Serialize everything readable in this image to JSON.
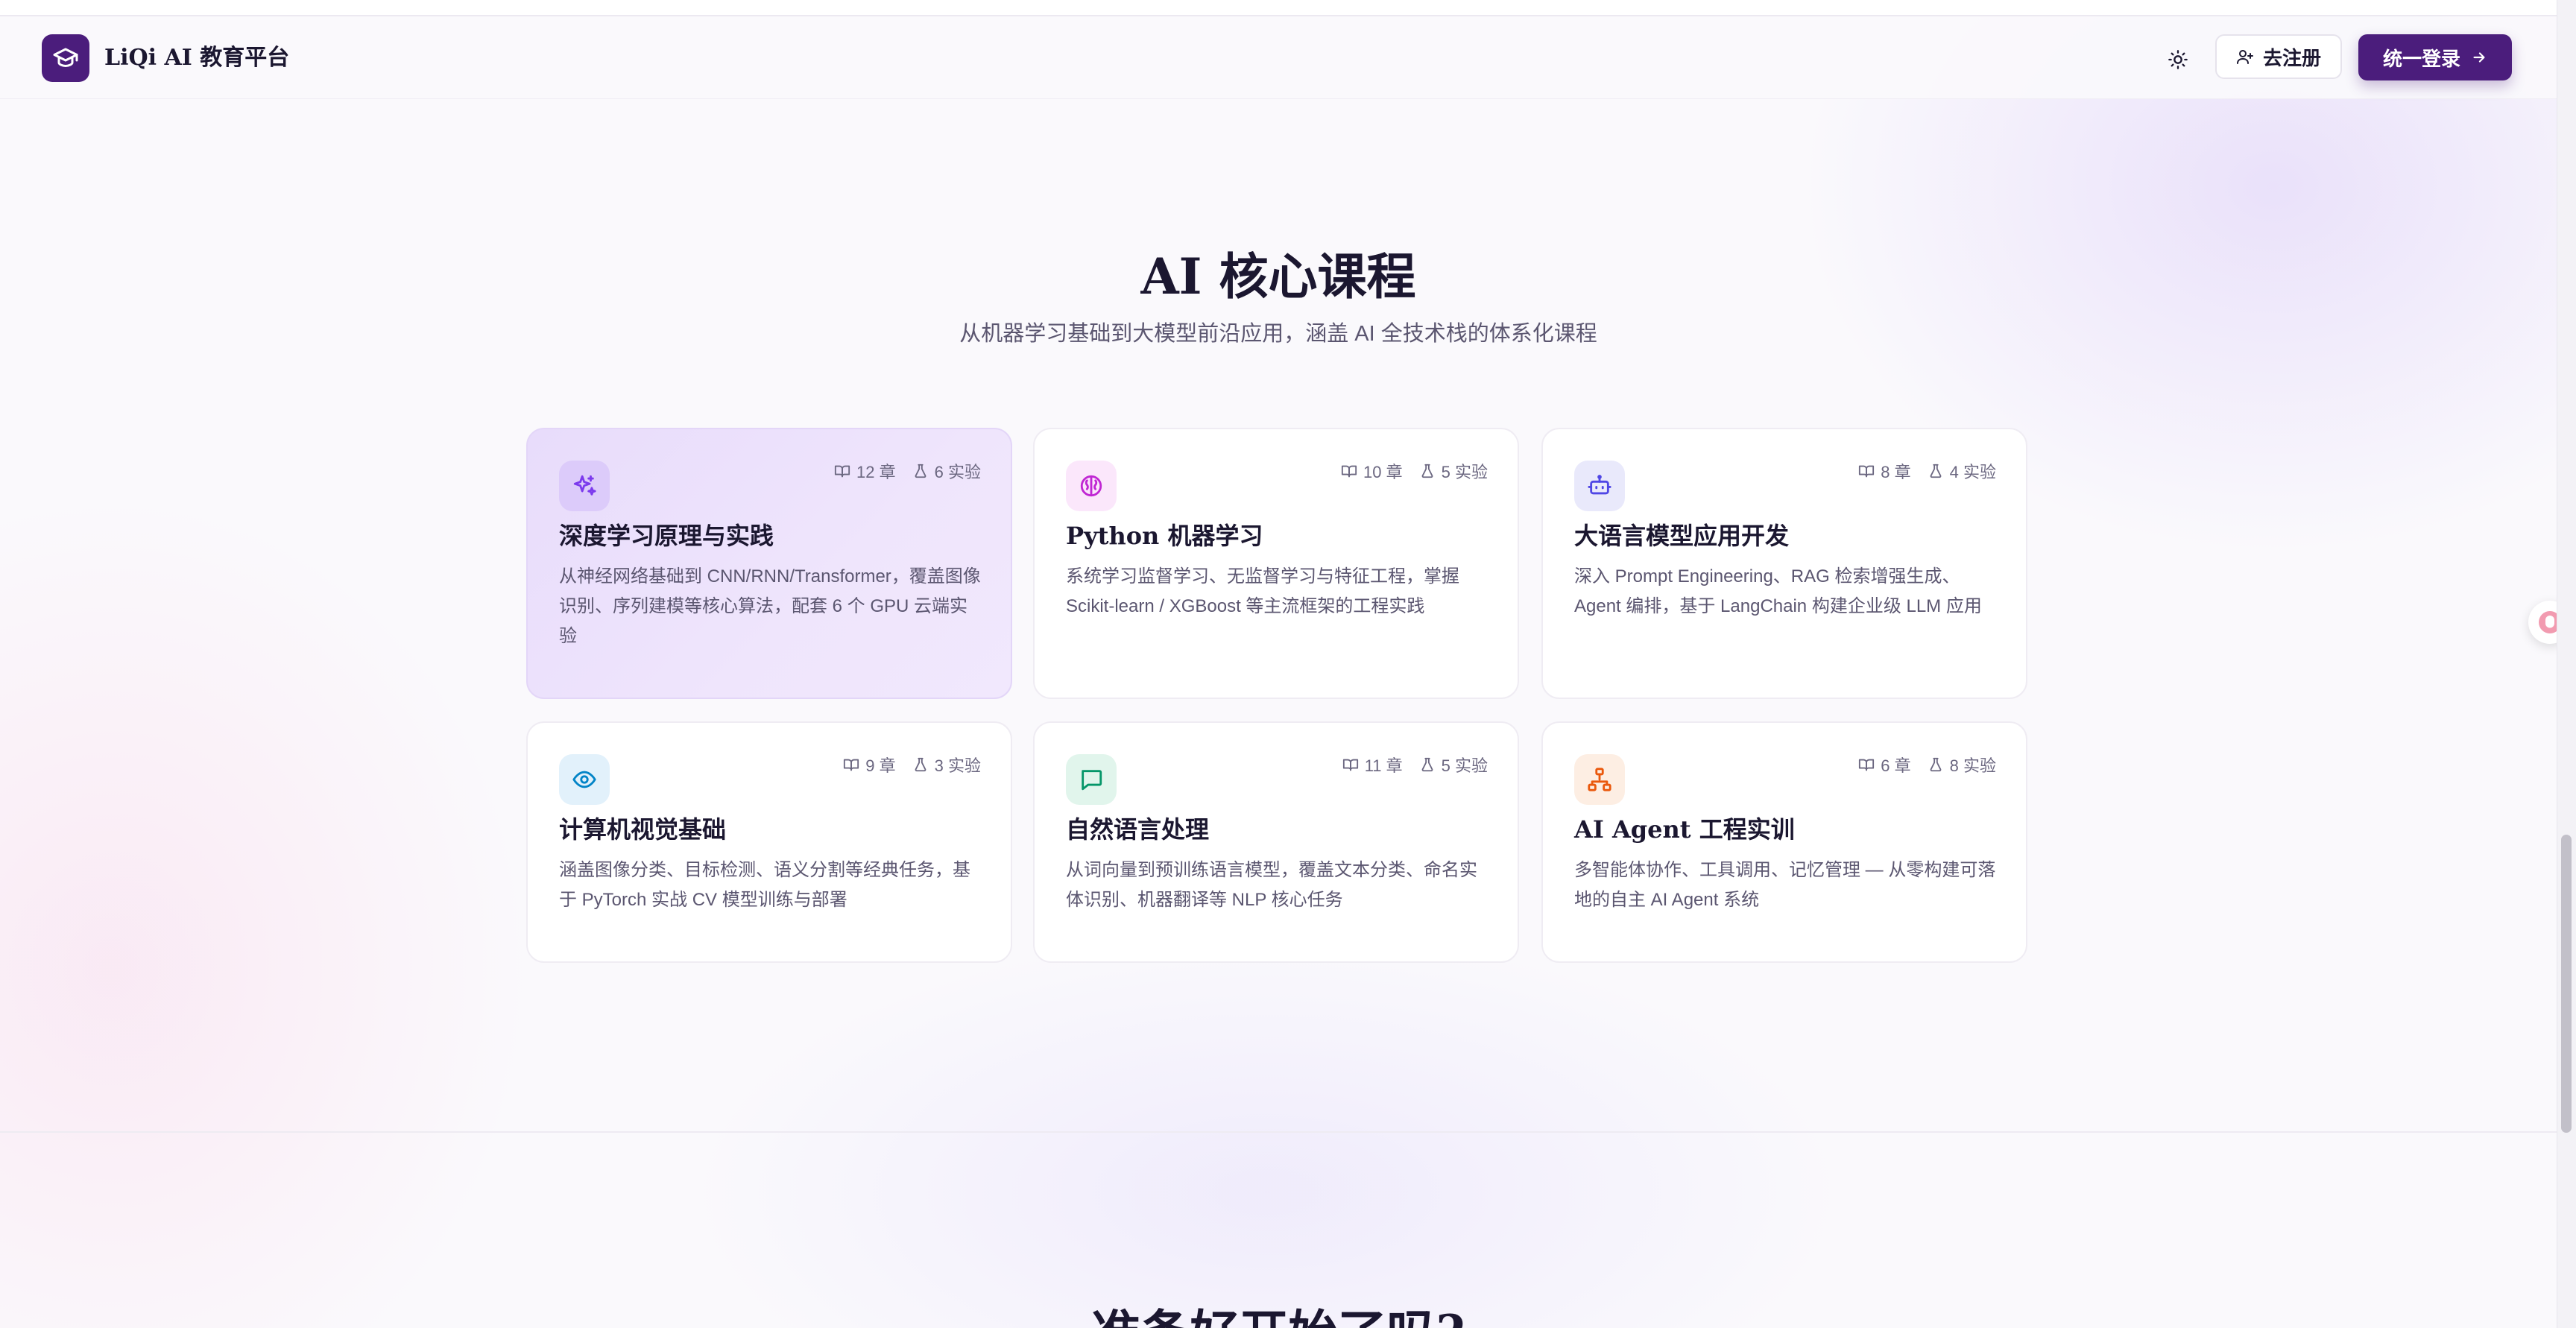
{
  "header": {
    "brand": "LiQi AI 教育平台",
    "register_label": "去注册",
    "login_label": "统一登录"
  },
  "section": {
    "title": "AI 核心课程",
    "subtitle": "从机器学习基础到大模型前沿应用，涵盖 AI 全技术栈的体系化课程"
  },
  "courses": [
    {
      "chapters": "12 章",
      "labs": "6 实验",
      "title": "深度学习原理与实践",
      "desc": "从神经网络基础到 CNN/RNN/Transformer，覆盖图像识别、序列建模等核心算法，配套 6 个 GPU 云端实验",
      "icon": "sparkles-icon",
      "icon_color": "#7c3aed",
      "icon_bg": "#dccbfa"
    },
    {
      "chapters": "10 章",
      "labs": "5 实验",
      "title": "Python 机器学习",
      "desc": "系统学习监督学习、无监督学习与特征工程，掌握 Scikit-learn / XGBoost 等主流框架的工程实践",
      "icon": "brain-icon",
      "icon_color": "#c026d3",
      "icon_bg": "#fbe7fb"
    },
    {
      "chapters": "8 章",
      "labs": "4 实验",
      "title": "大语言模型应用开发",
      "desc": "深入 Prompt Engineering、RAG 检索增强生成、Agent 编排，基于 LangChain 构建企业级 LLM 应用",
      "icon": "robot-icon",
      "icon_color": "#4f46e5",
      "icon_bg": "#e9e9fb"
    },
    {
      "chapters": "9 章",
      "labs": "3 实验",
      "title": "计算机视觉基础",
      "desc": "涵盖图像分类、目标检测、语义分割等经典任务，基于 PyTorch 实战 CV 模型训练与部署",
      "icon": "eye-icon",
      "icon_color": "#0284c7",
      "icon_bg": "#e2f1fb"
    },
    {
      "chapters": "11 章",
      "labs": "5 实验",
      "title": "自然语言处理",
      "desc": "从词向量到预训练语言模型，覆盖文本分类、命名实体识别、机器翻译等 NLP 核心任务",
      "icon": "chat-icon",
      "icon_color": "#059669",
      "icon_bg": "#e1f5ec"
    },
    {
      "chapters": "6 章",
      "labs": "8 实验",
      "title": "AI Agent 工程实训",
      "desc": "多智能体协作、工具调用、记忆管理 — 从零构建可落地的自主 AI Agent 系统",
      "icon": "network-icon",
      "icon_color": "#ea580c",
      "icon_bg": "#fdeee3"
    }
  ],
  "cta": {
    "title": "准备好开始了吗?"
  }
}
